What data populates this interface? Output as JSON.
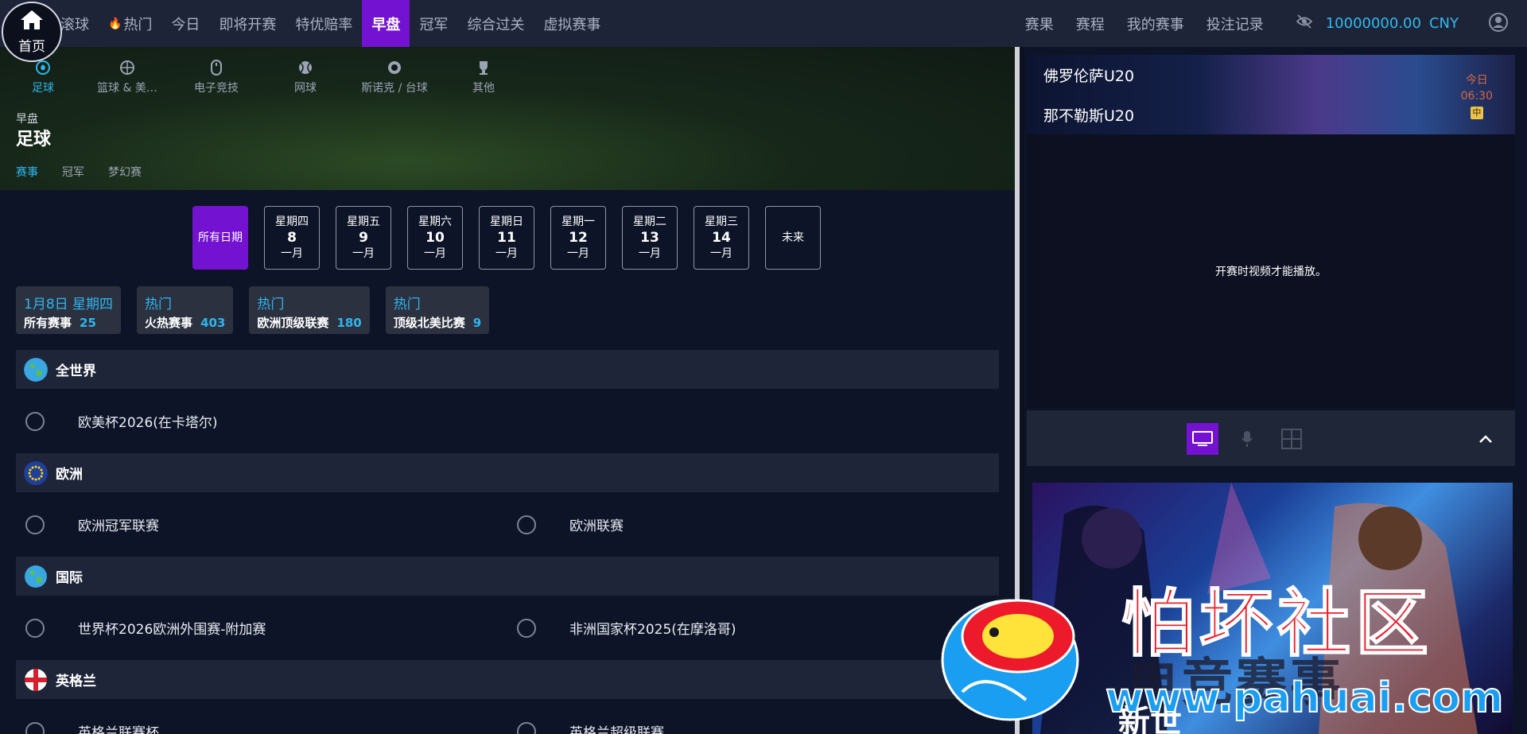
{
  "home": {
    "label": "首页"
  },
  "nav": {
    "items": [
      {
        "label": "滚球"
      },
      {
        "label": "热门"
      },
      {
        "label": "今日"
      },
      {
        "label": "即将开赛"
      },
      {
        "label": "特优赔率"
      },
      {
        "label": "早盘",
        "active": true
      },
      {
        "label": "冠军"
      },
      {
        "label": "综合过关"
      },
      {
        "label": "虚拟赛事"
      }
    ],
    "right_items": [
      {
        "label": "赛果"
      },
      {
        "label": "赛程"
      },
      {
        "label": "我的赛事"
      },
      {
        "label": "投注记录"
      }
    ],
    "balance": "10000000.00",
    "currency": "CNY"
  },
  "sports": [
    {
      "label": "足球",
      "icon": "soccer-icon",
      "active": true
    },
    {
      "label": "篮球 & 美…",
      "icon": "basketball-icon"
    },
    {
      "label": "电子竞技",
      "icon": "mouse-icon"
    },
    {
      "label": "网球",
      "icon": "tennis-icon"
    },
    {
      "label": "斯诺克 / 台球",
      "icon": "billiards-icon"
    },
    {
      "label": "其他",
      "icon": "trophy-icon"
    }
  ],
  "hero": {
    "subtitle": "早盘",
    "title": "足球",
    "tabs": [
      {
        "label": "赛事",
        "active": true
      },
      {
        "label": "冠军"
      },
      {
        "label": "梦幻赛"
      }
    ]
  },
  "dates": [
    {
      "label": "所有日期",
      "active": true
    },
    {
      "weekday": "星期四",
      "day": "8",
      "month": "一月"
    },
    {
      "weekday": "星期五",
      "day": "9",
      "month": "一月"
    },
    {
      "weekday": "星期六",
      "day": "10",
      "month": "一月"
    },
    {
      "weekday": "星期日",
      "day": "11",
      "month": "一月"
    },
    {
      "weekday": "星期一",
      "day": "12",
      "month": "一月"
    },
    {
      "weekday": "星期二",
      "day": "13",
      "month": "一月"
    },
    {
      "weekday": "星期三",
      "day": "14",
      "month": "一月"
    },
    {
      "label": "未来"
    }
  ],
  "chips": [
    {
      "top": "1月8日 星期四",
      "name": "所有赛事",
      "count": "25"
    },
    {
      "top": "热门",
      "name": "火热赛事",
      "count": "403"
    },
    {
      "top": "热门",
      "name": "欧洲顶级联赛",
      "count": "180"
    },
    {
      "top": "热门",
      "name": "顶级北美比赛",
      "count": "9"
    }
  ],
  "regions": [
    {
      "name": "全世界",
      "icon": "globe-icon",
      "leagues": [
        "欧美杯2026(在卡塔尔)"
      ]
    },
    {
      "name": "欧洲",
      "icon": "eu-flag-icon",
      "leagues": [
        "欧洲冠军联赛",
        "欧洲联赛"
      ]
    },
    {
      "name": "国际",
      "icon": "globe-icon",
      "leagues": [
        "世界杯2026欧洲外围赛-附加赛",
        "非洲国家杯2025(在摩洛哥)"
      ]
    },
    {
      "name": "英格兰",
      "icon": "england-flag-icon",
      "leagues": [
        "英格兰联赛杯",
        "英格兰超级联赛"
      ]
    }
  ],
  "match": {
    "home": "佛罗伦萨U20",
    "away": "那不勒斯U20",
    "day": "今日",
    "time": "06:30",
    "tag": "中"
  },
  "video": {
    "message": "开赛时视频才能播放。"
  },
  "watermark": {
    "title": "怕坏社区",
    "url": "www.pahuai.com"
  },
  "banner": {
    "title": "电竞赛事",
    "subtitle": "新世"
  },
  "colors": {
    "accent": "#7412d1",
    "link": "#2fb5ec",
    "nav_bg": "#1d2438",
    "page_bg": "#0e1428"
  }
}
